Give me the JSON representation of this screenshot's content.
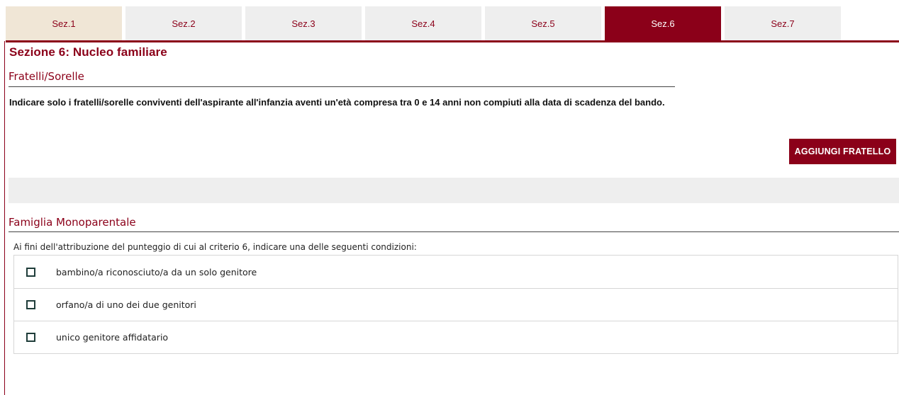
{
  "tabs": [
    {
      "label": "Sez.1",
      "active": false
    },
    {
      "label": "Sez.2",
      "active": false
    },
    {
      "label": "Sez.3",
      "active": false
    },
    {
      "label": "Sez.4",
      "active": false
    },
    {
      "label": "Sez.5",
      "active": false
    },
    {
      "label": "Sez.6",
      "active": true
    },
    {
      "label": "Sez.7",
      "active": false
    }
  ],
  "section_title": "Sezione 6: Nucleo familiare",
  "siblings": {
    "heading": "Fratelli/Sorelle",
    "note": "Indicare solo i fratelli/sorelle conviventi dell'aspirante all'infanzia aventi un'età compresa tra 0 e 14 anni non compiuti alla data di scadenza del bando.",
    "add_button": "AGGIUNGI FRATELLO"
  },
  "single_parent": {
    "heading": "Famiglia Monoparentale",
    "intro": "Ai fini dell'attribuzione del punteggio di cui al criterio 6, indicare una delle seguenti condizioni:",
    "options": [
      {
        "label": "bambino/a riconosciuto/a da un solo genitore",
        "checked": false
      },
      {
        "label": "orfano/a di uno dei due genitori",
        "checked": false
      },
      {
        "label": "unico genitore affidatario",
        "checked": false
      }
    ]
  },
  "colors": {
    "accent": "#8b0019",
    "tab_inactive": "#eeeeee",
    "tab_first": "#f0e6d6"
  }
}
